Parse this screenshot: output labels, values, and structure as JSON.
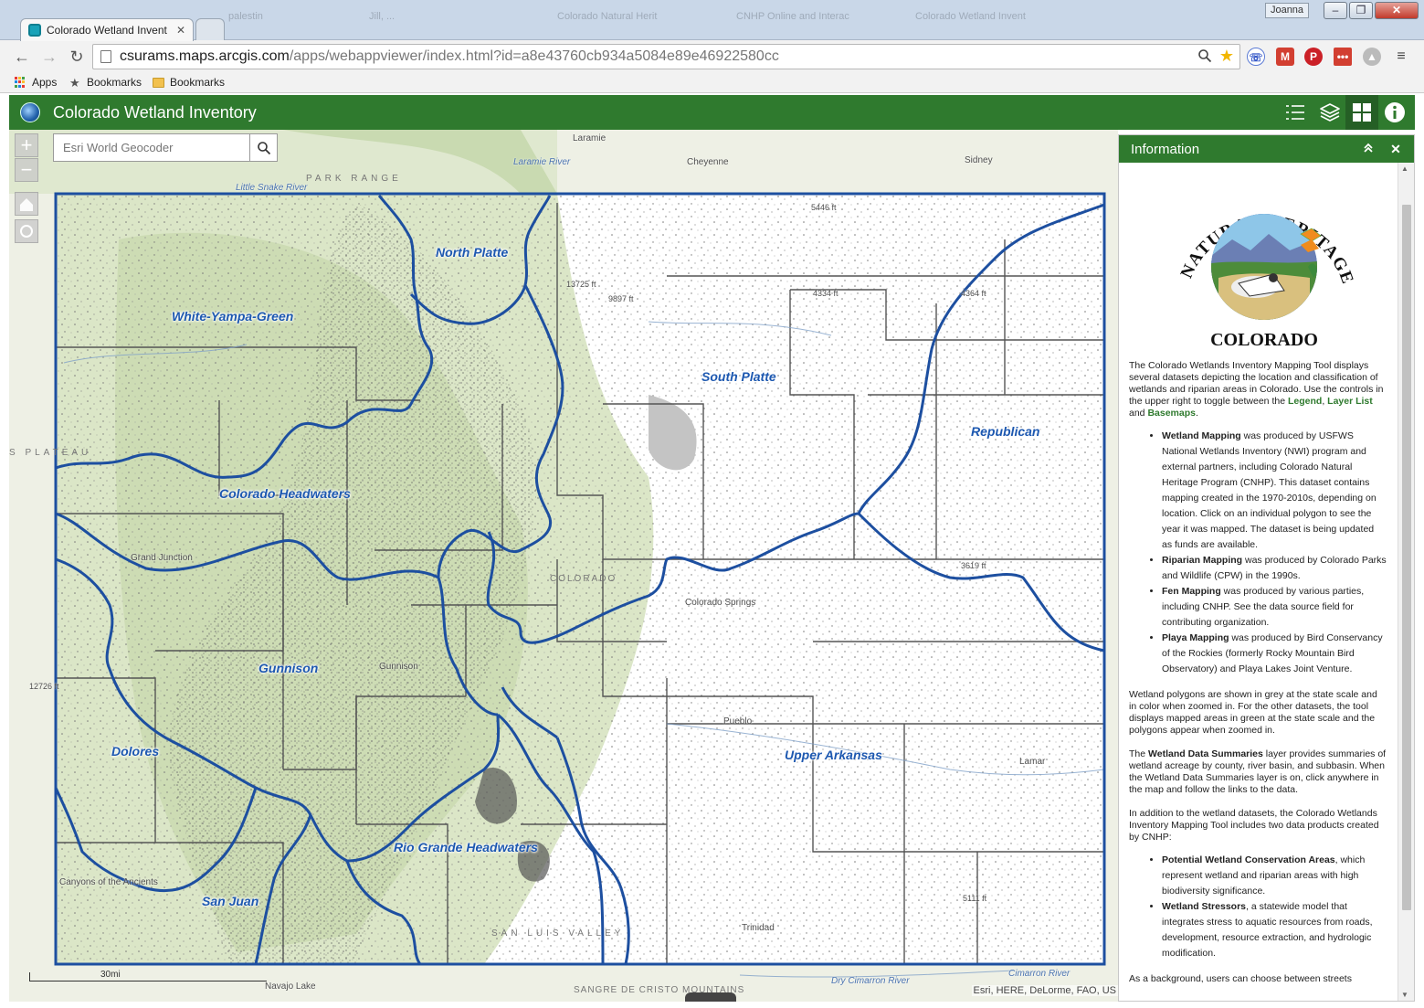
{
  "browser": {
    "active_tab": "Colorado Wetland Invent",
    "ghost_tabs": [
      "palestin",
      "Jill, ...",
      "Colorado Natural Herit",
      "CNHP Online and Interac",
      "Colorado Wetland Invent"
    ],
    "window_user": "Joanna",
    "url_host": "csurams.maps.arcgis.com",
    "url_path": "/apps/webappviewer/index.html?id=a8e43760cb934a5084e89e46922580cc",
    "bookmarks": [
      {
        "label": "Apps",
        "icon": "apps-grid-icon"
      },
      {
        "label": "Bookmarks",
        "icon": "star-icon"
      },
      {
        "label": "Bookmarks",
        "icon": "folder-icon"
      }
    ]
  },
  "app": {
    "title": "Colorado Wetland Inventory",
    "colors": {
      "header": "#2f7a2e",
      "basin_boundary": "#1d4fa0"
    },
    "header_tools": [
      "legend-icon",
      "layers-icon",
      "basemap-gallery-icon",
      "info-icon"
    ]
  },
  "map": {
    "search_placeholder": "Esri World Geocoder",
    "zoom_in": "+",
    "zoom_out": "−",
    "basins": [
      "North Platte",
      "White-Yampa-Green",
      "South Platte",
      "Republican",
      "Colorado Headwaters",
      "Gunnison",
      "Dolores",
      "Upper Arkansas",
      "Rio Grande Headwaters",
      "San Juan"
    ],
    "places": [
      "Laramie",
      "Cheyenne",
      "Sidney",
      "Grand Junction",
      "Gunnison",
      "Colorado Springs",
      "Pueblo",
      "Trinidad",
      "Lamar",
      "Canyons of the Ancients",
      "Navajo Lake"
    ],
    "regions": [
      "PARK RANGE",
      "S PLATEAU",
      "SAN LUIS VALLEY",
      "SANGRE DE CRISTO MOUNTAINS",
      "COLORADO"
    ],
    "rivers": [
      "Little Snake River",
      "Laramie River",
      "Cimarron River",
      "Dry Cimarron River"
    ],
    "elevations": [
      "5446 ft",
      "4364 ft",
      "4334 ft",
      "12726 ft",
      "5111 ft",
      "9897 ft",
      "3619 ft",
      "13725 ft"
    ],
    "scale_text": "30mi",
    "attribution": "Esri, HERE, DeLorme, FAO, US"
  },
  "panel": {
    "title": "Information",
    "logo_arc_text": "NATURAL HERITAGE PROGRAM",
    "logo_bottom_text": "COLORADO",
    "intro": {
      "text": "The Colorado Wetlands Inventory Mapping Tool displays several datasets depicting the location and classification of wetlands and riparian areas in Colorado. Use the controls in the upper right to toggle between the ",
      "link1": "Legend",
      "sep1": ", ",
      "link2": "Layer List",
      "sep2": " and ",
      "link3": "Basemaps",
      "end": "."
    },
    "datasets": [
      {
        "name": "Wetland Mapping",
        "text": " was produced by USFWS National Wetlands Inventory (NWI) program and external partners, including Colorado Natural Heritage Program (CNHP). This dataset contains mapping created in the 1970-2010s, depending on location. Click on an individual polygon to see the year it was mapped. The dataset is being updated as funds are available."
      },
      {
        "name": "Riparian Mapping",
        "text": " was produced by Colorado Parks and Wildlife (CPW) in the 1990s."
      },
      {
        "name": "Fen Mapping",
        "text": " was produced by various parties, including CNHP. See the data source field for contributing organization."
      },
      {
        "name": "Playa Mapping",
        "text": " was produced by Bird Conservancy of the Rockies (formerly Rocky Mountain Bird Observatory) and Playa Lakes Joint Venture."
      }
    ],
    "para2": "Wetland polygons are shown in grey at the state scale and in color when zoomed in. For the other datasets, the tool displays mapped areas in green at the state scale and the polygons appear when zoomed in.",
    "para3": {
      "pre": "The ",
      "bold": "Wetland Data Summaries",
      "post": " layer provides summaries of wetland acreage by county, river basin, and subbasin. When the Wetland Data Summaries layer is on, click anywhere in the map and follow the links to the data."
    },
    "para4": "In addition to the wetland datasets, the Colorado Wetlands Inventory Mapping Tool includes two data products created by CNHP:",
    "products": [
      {
        "name": "Potential Wetland Conservation Areas",
        "text": ", which represent wetland and riparian areas with high biodiversity significance."
      },
      {
        "name": "Wetland Stressors",
        "text": ", a statewide model that integrates stress to aquatic resources from roads, development, resource extraction, and hydrologic modification."
      }
    ],
    "para5": "As a background, users can choose between streets"
  }
}
